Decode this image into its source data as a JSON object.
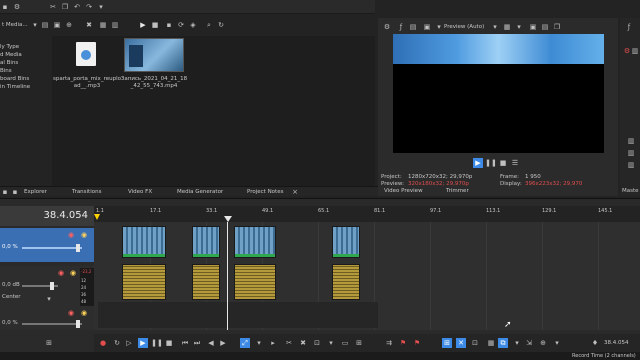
{
  "explorer": {
    "media_label": "t Media...",
    "tree": [
      "ly Type",
      "d Media",
      "al Bins",
      "Bins",
      "board Bins",
      "in Timeline"
    ],
    "files": [
      {
        "name": "sparta_porta_mix_reuplo ad__.mp3",
        "kind": "audio"
      },
      {
        "name": "Запись_2021_04_21_18 _42_55_743.mp4",
        "kind": "video"
      }
    ]
  },
  "tabs": {
    "explorer": "Explorer",
    "transitions": "Transitions",
    "video_fx": "Video FX",
    "media_generator": "Media Generator",
    "project_notes": "Project Notes",
    "video_preview": "Video Preview",
    "trimmer": "Trimmer",
    "master": "Maste"
  },
  "preview": {
    "mode_label": "Preview (Auto)",
    "project_label": "Project:",
    "project_value": "1280x720x32; 29,970p",
    "preview_label": "Preview:",
    "preview_value": "320x180x32; 29,970p",
    "display_label": "Display:",
    "display_value": "396x223x32; 29,970",
    "frame_label": "Frame:",
    "frame_value": "1 950"
  },
  "timeline": {
    "timecode": "38.4.054",
    "bottom_timecode": "38.4.054",
    "ruler_marks": [
      "1.1",
      "17.1",
      "33.1",
      "49.1",
      "65.1",
      "81.1",
      "97.1",
      "113.1",
      "129.1",
      "145.1"
    ],
    "track1_level": "0,0 %",
    "track2_level": "0,0 dB",
    "track2_pan": "Center",
    "track3_level": "0,0 %",
    "audio_db_scale": [
      "-23,2",
      "12",
      "24",
      "36",
      "48"
    ],
    "record_time": "Record Time (2 channels)"
  }
}
